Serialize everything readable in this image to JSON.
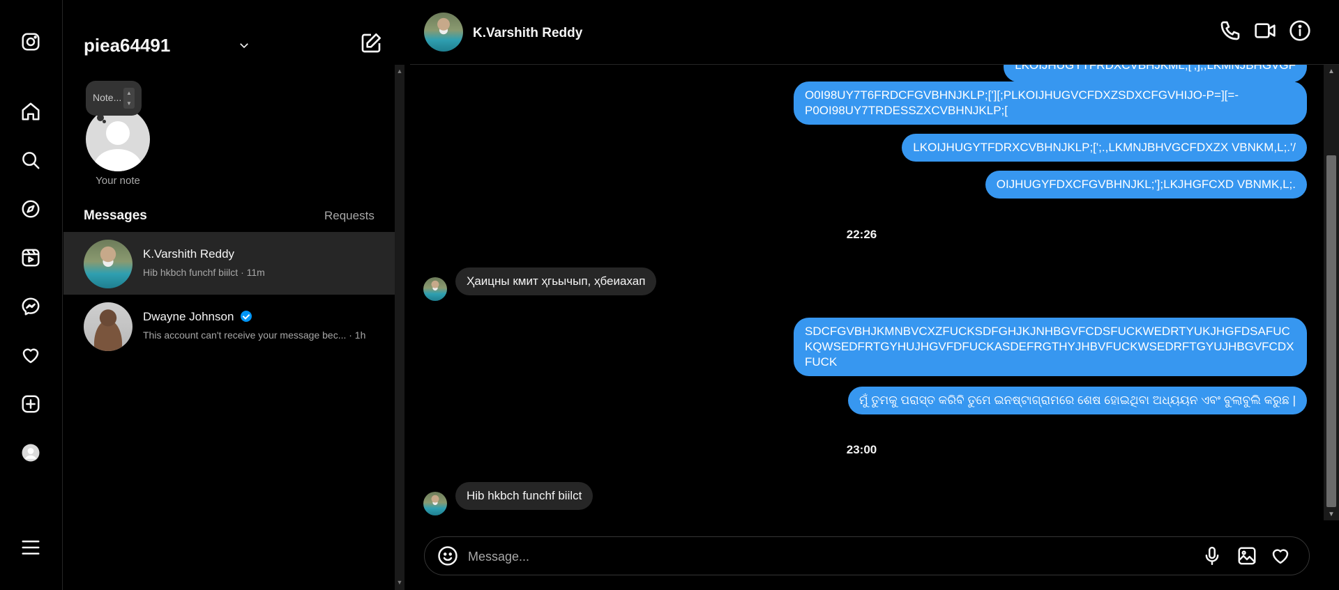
{
  "rail": {
    "items": [
      "instagram-logo",
      "home",
      "search",
      "explore",
      "reels",
      "messages",
      "notifications",
      "create",
      "profile",
      "more"
    ]
  },
  "sidebar": {
    "account_name": "piea64491",
    "note_placeholder": "Note...",
    "your_note_label": "Your note",
    "messages_heading": "Messages",
    "requests_label": "Requests",
    "conversations": [
      {
        "name": "K.Varshith Reddy",
        "preview": "Hib hkbch funchf biilct · 11m",
        "active": true,
        "verified": false
      },
      {
        "name": "Dwayne Johnson",
        "preview": "This account can't receive your message bec... · 1h",
        "active": false,
        "verified": true
      }
    ]
  },
  "chat": {
    "contact_name": "K.Varshith Reddy",
    "messages": {
      "m0": "LKOIJHUGYTFRDXCVBHJKML;[';],;LKMNJBHGVGF",
      "m1": "O0I98UY7T6FRDCFGVBHNJKLP;['][;PLKOIJHUGVCFDXZSDXCFGVHIJO-P=][=-P0OI98UY7TRDESSZXCVBHNJKLP;[",
      "m2": "LKOIJHUGYTFDRXCVBHNJKLP;[';.,LKMNJBHVGCFDXZX VBNKM,L;.'/",
      "m3": "OIJHUGYFDXCFGVBHNJKL;'];LKJHGFCXD VBNMK,L;.",
      "ts1": "22:26",
      "m4": "Ҳаицны кмит ҳгьычып, ҳбеиахап",
      "m5": "SDCFGVBHJKMNBVCXZFUCKSDFGHJKJNHBGVFCDSFUCKWEDRTYUKJHGFDSAFUCKQWSEDFRTGYHUJHGVFDFUCKASDEFRGTHYJHBVFUCKWSEDRFTGYUJHBGVFCDXFUCK",
      "m6": "ମୁଁ ତୁମକୁ ପରାସ୍ତ କରିବି ତୁମେ ଇନଷ୍ଟାଗ୍ରାମରେ ଶେଷ ହୋଇଥିବା ଅଧ୍ୟୟନ ଏବଂ ବୁଲାବୁଲି କରୁଛ |",
      "ts2": "23:00",
      "m7": "Hib hkbch funchf biilct"
    },
    "composer_placeholder": "Message..."
  },
  "colors": {
    "background": "#000000",
    "outgoing_bubble": "#3797f0",
    "incoming_bubble": "#262626",
    "active_row": "#262626",
    "verified_badge": "#0095f6"
  }
}
